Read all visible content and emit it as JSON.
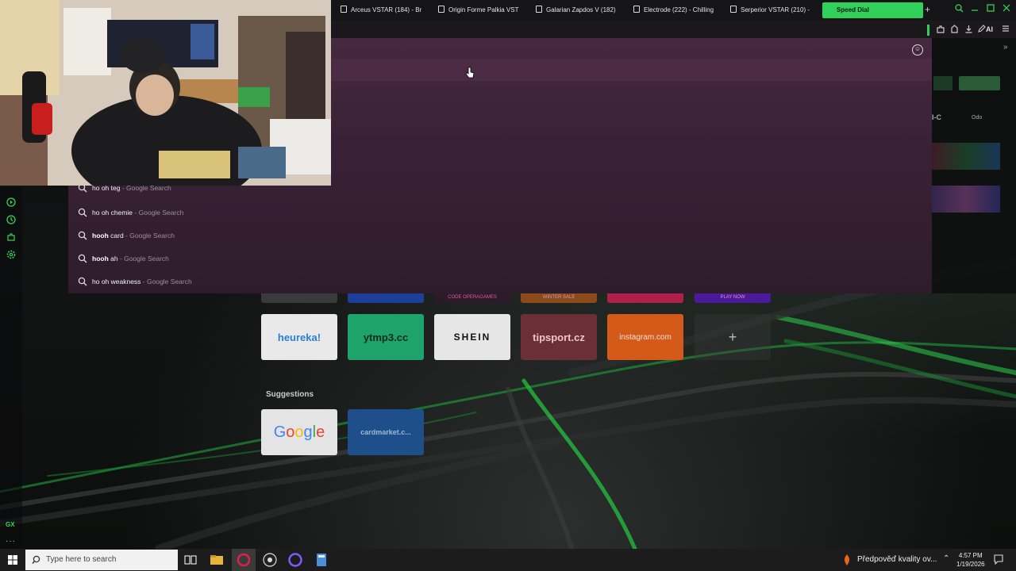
{
  "browser": {
    "tabs": [
      {
        "label": "Arceus VSTAR (184) - Br"
      },
      {
        "label": "Origin Forme Palkia VST"
      },
      {
        "label": "Galarian Zapdos V (182)"
      },
      {
        "label": "Electrode (222) - Chilling"
      },
      {
        "label": "Serperior VSTAR (210) -"
      },
      {
        "label": "Speed Dial"
      }
    ],
    "new_tab_glyph": "+",
    "ai_label": "AI"
  },
  "address_bar": {
    "value": ""
  },
  "suggestions": [
    {
      "query": "ho oh teg",
      "bold_part": "",
      "source": "Google Search"
    },
    {
      "query": "ho oh chemie",
      "bold_part": "",
      "source": "Google Search"
    },
    {
      "query": " card",
      "bold_part": "hooh",
      "source": "Google Search"
    },
    {
      "query": " ah",
      "bold_part": "hooh",
      "source": "Google Search"
    },
    {
      "query": "ho oh weakness",
      "bold_part": "",
      "source": "Google Search"
    }
  ],
  "suggestion_separator": " - ",
  "speed_dial": {
    "top_strip": [
      "",
      "",
      "CODE  OPERAGAMES",
      "WINTER SALE",
      "",
      "PLAY NOW"
    ],
    "tiles": [
      {
        "label": "heureka!",
        "color": "#e9e9ea",
        "text_color": "#2a7fd4"
      },
      {
        "label": "ytmp3.cc",
        "color": "#1ea36a",
        "text_color": "#0f2a1e"
      },
      {
        "label": "SHEIN",
        "color": "#e6e6e6",
        "text_color": "#111111"
      },
      {
        "label": "tipsport.cz",
        "color": "#6a3036",
        "text_color": "#f0c5c5"
      },
      {
        "label": "instagram.com",
        "color": "#d45a1a",
        "text_color": "#f3e0d0"
      }
    ],
    "add_label": "+",
    "suggestions_heading": "Suggestions",
    "suggested_tiles": [
      {
        "label": "Google",
        "color": "#e4e4e4"
      },
      {
        "label": "cardmarket.c...",
        "color": "#1f4f8a",
        "text_color": "#9bb8d8"
      }
    ]
  },
  "right_panel": {
    "code_text": "I-C",
    "small_text": "Odo"
  },
  "sidebar": {
    "gx_label": "GX",
    "more_label": "···"
  },
  "taskbar": {
    "search_placeholder": "Type here to search",
    "notification_text": "Předpověď kvality ov...",
    "time": "4:57 PM",
    "date": "1/19/2026"
  }
}
